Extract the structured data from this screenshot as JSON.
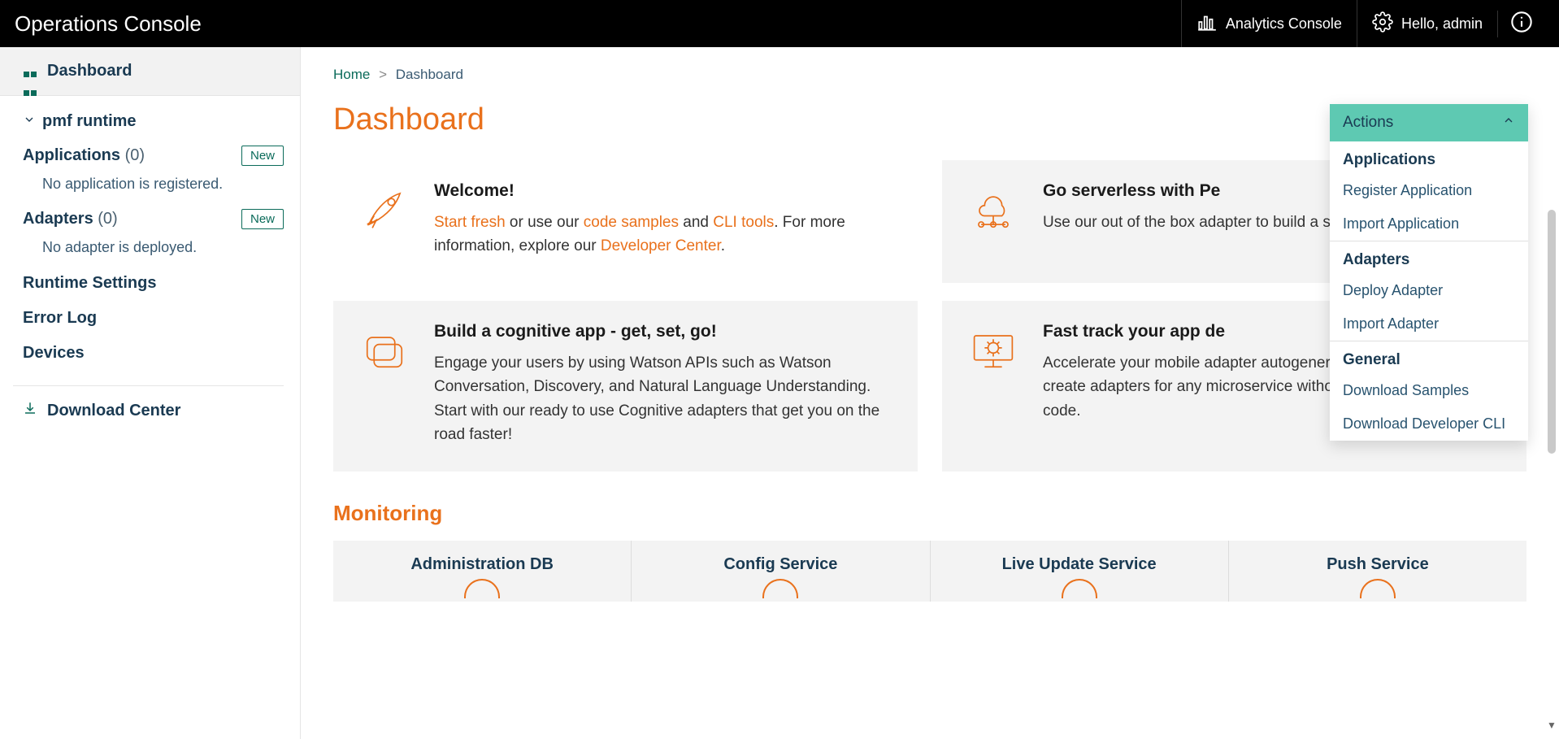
{
  "header": {
    "title": "Operations Console",
    "analytics_label": "Analytics Console",
    "greeting": "Hello, admin"
  },
  "sidebar": {
    "dashboard_label": "Dashboard",
    "runtime": {
      "label": "pmf runtime"
    },
    "applications": {
      "label": "Applications",
      "count": "(0)",
      "new_label": "New",
      "empty": "No application is registered."
    },
    "adapters": {
      "label": "Adapters",
      "count": "(0)",
      "new_label": "New",
      "empty": "No adapter is deployed."
    },
    "runtime_settings": "Runtime Settings",
    "error_log": "Error Log",
    "devices": "Devices",
    "download_center": "Download Center"
  },
  "breadcrumb": {
    "home": "Home",
    "sep": ">",
    "current": "Dashboard"
  },
  "page_title": "Dashboard",
  "cards": {
    "welcome": {
      "title": "Welcome!",
      "link_start": "Start fresh",
      "text1": " or use our ",
      "link_samples": "code samples",
      "text2": " and ",
      "link_cli": "CLI tools",
      "text3": ". For more information, explore our ",
      "link_dev": "Developer Center",
      "text4": "."
    },
    "serverless": {
      "title": "Go serverless with Pe",
      "body": "Use our out of the box adapter to build a serve"
    },
    "cognitive": {
      "title": "Build a cognitive app - get, set, go!",
      "body": "Engage your users by using Watson APIs such as Watson Conversation, Discovery, and Natural Language Understanding. Start with our ready to use Cognitive adapters that get you on the road faster!"
    },
    "fasttrack": {
      "title": "Fast track your app de",
      "body": "Accelerate your mobile adapter autogeneration capability to quickly create adapters for any microservice without writing a single line of code."
    }
  },
  "monitoring": {
    "title": "Monitoring",
    "items": [
      "Administration DB",
      "Config Service",
      "Live Update Service",
      "Push Service"
    ]
  },
  "actions": {
    "button": "Actions",
    "groups": [
      {
        "title": "Applications",
        "items": [
          "Register Application",
          "Import Application"
        ]
      },
      {
        "title": "Adapters",
        "items": [
          "Deploy Adapter",
          "Import Adapter"
        ]
      },
      {
        "title": "General",
        "items": [
          "Download Samples",
          "Download Developer CLI"
        ]
      }
    ]
  }
}
